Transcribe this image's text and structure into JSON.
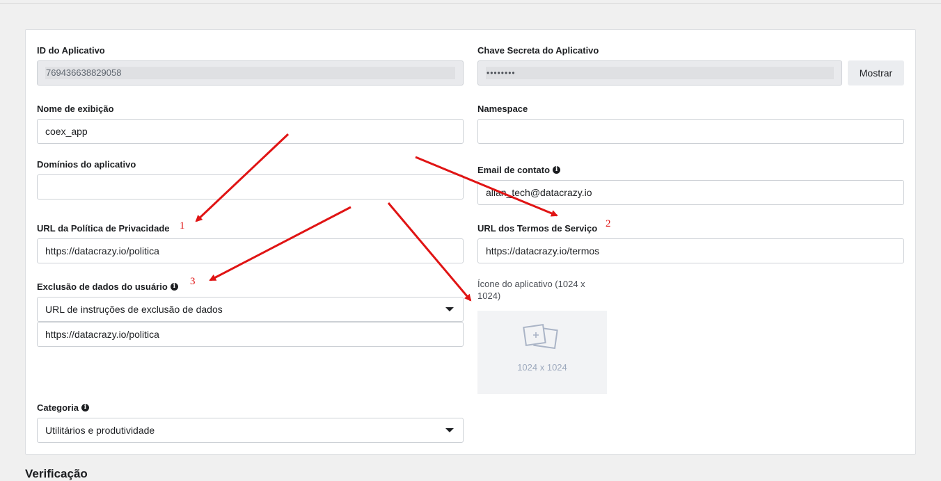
{
  "fields": {
    "app_id": {
      "label": "ID do Aplicativo",
      "value": "769436638829058"
    },
    "app_secret": {
      "label": "Chave Secreta do Aplicativo",
      "value": "••••••••",
      "show_button": "Mostrar"
    },
    "display_name": {
      "label": "Nome de exibição",
      "value": "coex_app"
    },
    "namespace": {
      "label": "Namespace",
      "value": ""
    },
    "app_domains": {
      "label": "Domínios do aplicativo",
      "value": ""
    },
    "contact_email": {
      "label": "Email de contato",
      "value": "allan_tech@datacrazy.io"
    },
    "privacy_url": {
      "label": "URL da Política de Privacidade",
      "value": "https://datacrazy.io/politica"
    },
    "terms_url": {
      "label": "URL dos Termos de Serviço",
      "value": "https://datacrazy.io/termos"
    },
    "data_deletion": {
      "label": "Exclusão de dados do usuário",
      "selected": "URL de instruções de exclusão de dados",
      "value": "https://datacrazy.io/politica"
    },
    "app_icon": {
      "label": "Ícone do aplicativo (1024 x 1024)",
      "placeholder": "1024 x 1024"
    },
    "category": {
      "label": "Categoria",
      "selected": "Utilitários e produtividade"
    }
  },
  "annotations": {
    "one": "1",
    "two": "2",
    "three": "3"
  },
  "sections": {
    "next_title": "Verificação"
  },
  "colors": {
    "annotation": "#e01414",
    "page_bg": "#f0f0f0",
    "card_bg": "#ffffff"
  },
  "icons": {
    "info": "info-icon",
    "dropdown": "chevron-down-icon",
    "image_placeholder": "image-add-icon"
  }
}
